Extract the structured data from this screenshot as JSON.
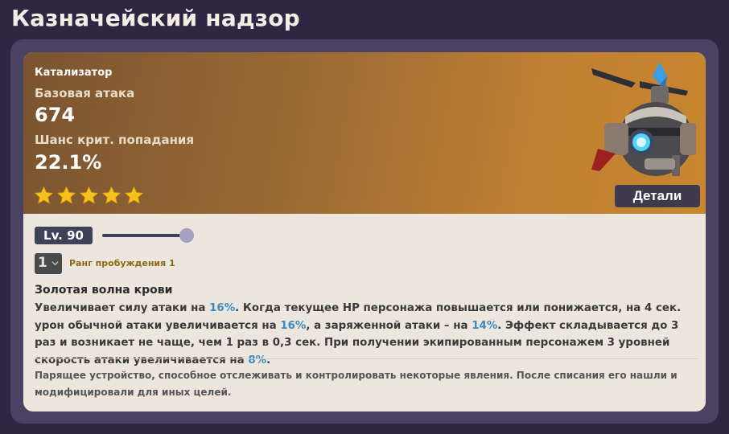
{
  "page": {
    "title": "Казначейский надзор"
  },
  "weapon": {
    "type": "Катализатор",
    "stat1_label": "Базовая атака",
    "stat1_value": "674",
    "stat2_label": "Шанс крит. попадания",
    "stat2_value": "22.1%",
    "rarity_stars": 5,
    "details_label": "Детали",
    "star_color": "#f6c21a",
    "header_gradient": [
      "#7a5430",
      "#c9862f"
    ]
  },
  "controls": {
    "level_label": "Lv. 90",
    "level_fraction": 1.0,
    "rank_value": "1",
    "rank_label": "Ранг пробуждения 1"
  },
  "effect": {
    "name": "Золотая волна крови",
    "desc_1": "Увеличивает силу атаки на ",
    "v1": "16%",
    "desc_2": ". Когда текущее HP персонажа повышается или понижается, на 4 сек. урон обычной атаки увеличивается на ",
    "v2": "16%",
    "desc_3": ", а заряженной атаки – на ",
    "v3": "14%",
    "desc_4": ". Эффект складывается до 3 раз и возникает не чаще, чем 1 раз в 0,3 сек. При получении экипированным персонажем 3 уровней скорость атаки увеличивается на ",
    "v4": "8%",
    "desc_5": ".",
    "highlight_color": "#3b8bc2"
  },
  "lore": {
    "text": "Парящее устройство, способное отслеживать и контролировать некоторые явления. После списания его нашли и модифицировали для иных целей."
  }
}
